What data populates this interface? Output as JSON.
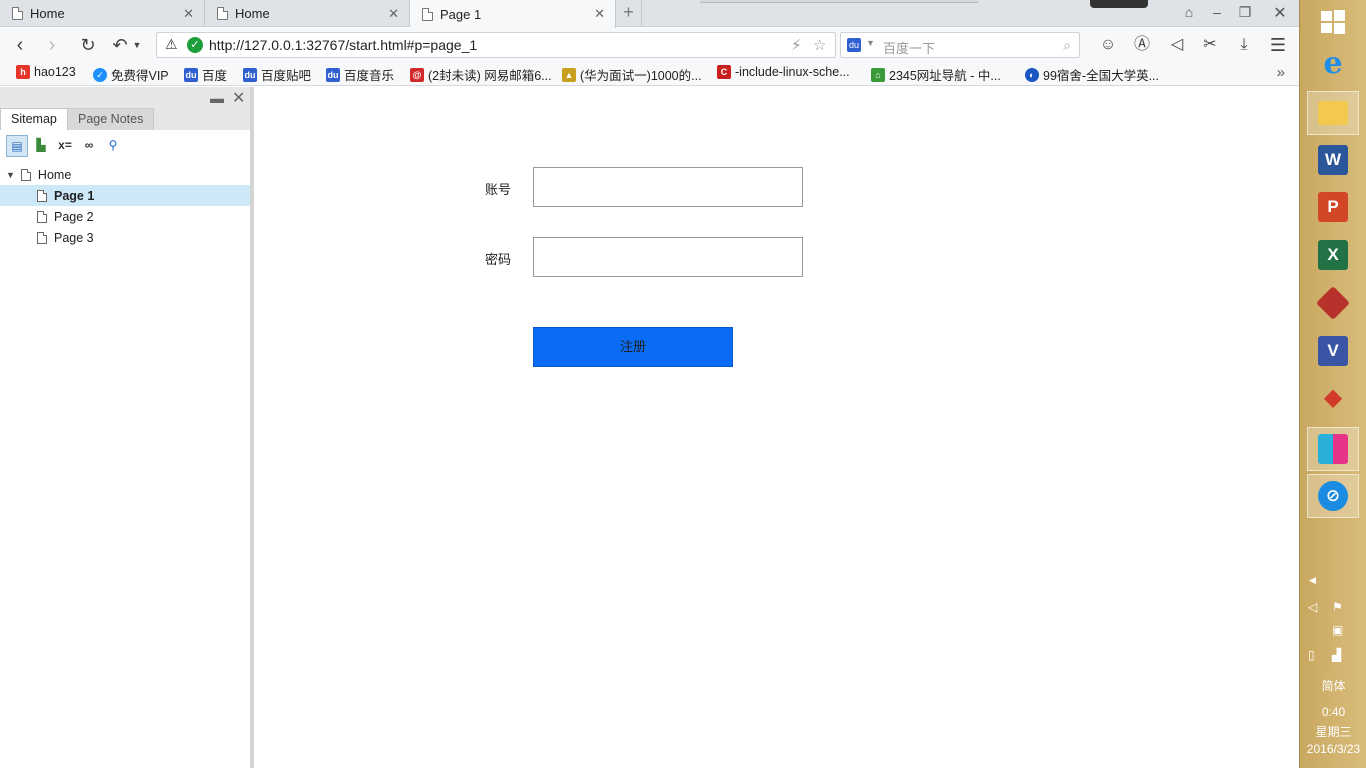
{
  "browser": {
    "tabs": [
      {
        "title": "Home",
        "close": "✕"
      },
      {
        "title": "Home",
        "close": "✕"
      },
      {
        "title": "Page 1",
        "close": "✕"
      }
    ],
    "new_tab": "+",
    "url": "http://127.0.0.1:32767/start.html#p=page_1",
    "search_placeholder": "百度一下",
    "bookmarks": [
      {
        "label": "hao123",
        "icon": "hao123-icon",
        "color": "#e8352a"
      },
      {
        "label": "免费得VIP",
        "icon": "vip-icon",
        "color": "#1e90ff"
      },
      {
        "label": "百度",
        "icon": "baidu-icon",
        "color": "#2f5fd0"
      },
      {
        "label": "百度贴吧",
        "icon": "baidu-icon",
        "color": "#2f5fd0"
      },
      {
        "label": "百度音乐",
        "icon": "baidu-icon",
        "color": "#2f5fd0"
      },
      {
        "label": "(2封未读) 网易邮箱6...",
        "icon": "netease-mail-icon",
        "color": "#d22a2a"
      },
      {
        "label": "(华为面试一)1000的...",
        "icon": "bookmark-site-icon",
        "color": "#c8a020"
      },
      {
        "label": "-include-linux-sche...",
        "icon": "csdn-icon",
        "color": "#c81f1f"
      },
      {
        "label": "2345网址导航 - 中...",
        "icon": "2345-icon",
        "color": "#3a9a3a"
      },
      {
        "label": "99宿舍-全国大学英...",
        "icon": "globe-icon",
        "color": "#1a56c0"
      }
    ]
  },
  "sidebar": {
    "tabs": [
      {
        "label": "Sitemap"
      },
      {
        "label": "Page Notes"
      }
    ],
    "tools": [
      "x="
    ],
    "tree": {
      "root": "Home",
      "pages": [
        "Page 1",
        "Page 2",
        "Page 3"
      ],
      "selected": "Page 1"
    }
  },
  "form": {
    "account_label": "账号",
    "password_label": "密码",
    "account_value": "",
    "password_value": "",
    "submit_label": "注册",
    "submit_color": "#0a6cf5"
  },
  "taskbar": {
    "ime": "简体",
    "time": "0:40",
    "weekday": "星期三",
    "date": "2016/3/23"
  }
}
